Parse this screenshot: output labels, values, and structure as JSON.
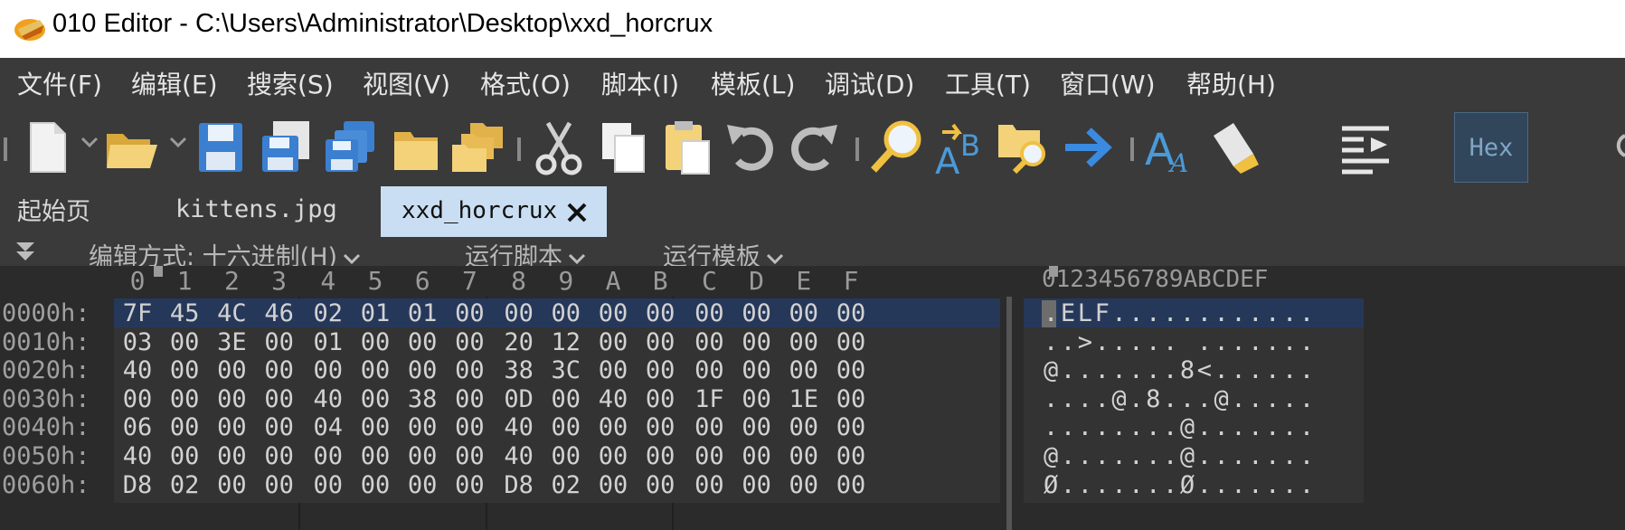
{
  "window": {
    "title": "010 Editor - C:\\Users\\Administrator\\Desktop\\xxd_horcrux",
    "icon": "app-logo-icon"
  },
  "menu": [
    "文件(F)",
    "编辑(E)",
    "搜索(S)",
    "视图(V)",
    "格式(O)",
    "脚本(I)",
    "模板(L)",
    "调试(D)",
    "工具(T)",
    "窗口(W)",
    "帮助(H)"
  ],
  "toolbar": {
    "hex_label": "Hex",
    "icons": [
      "new-file-icon",
      "open-folder-icon",
      "save-icon",
      "save-as-icon",
      "save-all-icon",
      "folder-icon",
      "folders-icon",
      "cut-icon",
      "copy-icon",
      "paste-icon",
      "undo-icon",
      "redo-icon",
      "find-icon",
      "replace-icon",
      "find-in-files-icon",
      "goto-icon",
      "font-icon",
      "highlight-icon",
      "hex-toggle",
      "columns-icon"
    ]
  },
  "tabs": {
    "items": [
      "起始页",
      "kittens.jpg"
    ],
    "active": "xxd_horcrux"
  },
  "options": {
    "edit_mode": "编辑方式: 十六进制(H)",
    "run_script": "运行脚本",
    "run_template": "运行模板"
  },
  "hex": {
    "columns": [
      "0",
      "1",
      "2",
      "3",
      "4",
      "5",
      "6",
      "7",
      "8",
      "9",
      "A",
      "B",
      "C",
      "D",
      "E",
      "F"
    ],
    "ascii_header": "0123456789ABCDEF",
    "rows": [
      {
        "addr": "0000h:",
        "bytes": [
          "7F",
          "45",
          "4C",
          "46",
          "02",
          "01",
          "01",
          "00",
          "00",
          "00",
          "00",
          "00",
          "00",
          "00",
          "00",
          "00"
        ],
        "ascii": ".ELF............"
      },
      {
        "addr": "0010h:",
        "bytes": [
          "03",
          "00",
          "3E",
          "00",
          "01",
          "00",
          "00",
          "00",
          "20",
          "12",
          "00",
          "00",
          "00",
          "00",
          "00",
          "00"
        ],
        "ascii": "..>..... ......."
      },
      {
        "addr": "0020h:",
        "bytes": [
          "40",
          "00",
          "00",
          "00",
          "00",
          "00",
          "00",
          "00",
          "38",
          "3C",
          "00",
          "00",
          "00",
          "00",
          "00",
          "00"
        ],
        "ascii": "@.......8<......"
      },
      {
        "addr": "0030h:",
        "bytes": [
          "00",
          "00",
          "00",
          "00",
          "40",
          "00",
          "38",
          "00",
          "0D",
          "00",
          "40",
          "00",
          "1F",
          "00",
          "1E",
          "00"
        ],
        "ascii": "....@.8...@....."
      },
      {
        "addr": "0040h:",
        "bytes": [
          "06",
          "00",
          "00",
          "00",
          "04",
          "00",
          "00",
          "00",
          "40",
          "00",
          "00",
          "00",
          "00",
          "00",
          "00",
          "00"
        ],
        "ascii": "........@......."
      },
      {
        "addr": "0050h:",
        "bytes": [
          "40",
          "00",
          "00",
          "00",
          "00",
          "00",
          "00",
          "00",
          "40",
          "00",
          "00",
          "00",
          "00",
          "00",
          "00",
          "00"
        ],
        "ascii": "@.......@......."
      },
      {
        "addr": "0060h:",
        "bytes": [
          "D8",
          "02",
          "00",
          "00",
          "00",
          "00",
          "00",
          "00",
          "D8",
          "02",
          "00",
          "00",
          "00",
          "00",
          "00",
          "00"
        ],
        "ascii": "Ø.......Ø......."
      }
    ]
  }
}
